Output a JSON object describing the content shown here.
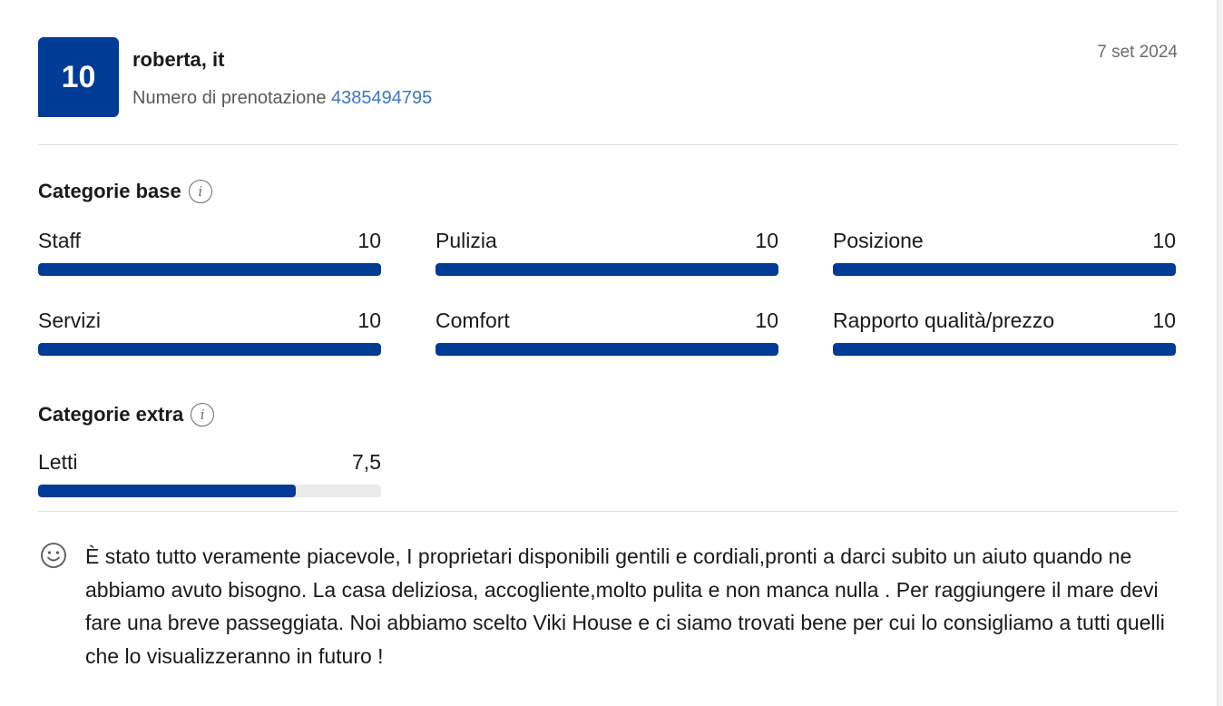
{
  "review": {
    "score": "10",
    "reviewer": "roberta, it",
    "booking_label": "Numero di prenotazione",
    "booking_number": "4385494795",
    "date": "7 set 2024"
  },
  "base_categories": {
    "title": "Categorie base",
    "items": [
      {
        "label": "Staff",
        "score": "10",
        "fraction": 1.0
      },
      {
        "label": "Pulizia",
        "score": "10",
        "fraction": 1.0
      },
      {
        "label": "Posizione",
        "score": "10",
        "fraction": 1.0
      },
      {
        "label": "Servizi",
        "score": "10",
        "fraction": 1.0
      },
      {
        "label": "Comfort",
        "score": "10",
        "fraction": 1.0
      },
      {
        "label": "Rapporto qualità/prezzo",
        "score": "10",
        "fraction": 1.0
      }
    ]
  },
  "extra_categories": {
    "title": "Categorie extra",
    "items": [
      {
        "label": "Letti",
        "score": "7,5",
        "fraction": 0.75
      }
    ]
  },
  "comment": {
    "icon": "smiley-icon",
    "text": "È stato tutto veramente piacevole, I proprietari disponibili gentili e cordiali,pronti a darci subito un aiuto quando ne abbiamo avuto bisogno. La casa deliziosa, accogliente,molto pulita e non manca nulla . Per raggiungere il mare devi fare una breve passeggiata. Noi abbiamo scelto Viki House e ci siamo trovati bene per cui lo consigliamo a tutti quelli che lo visualizzeranno in futuro !"
  },
  "colors": {
    "accent": "#003b95",
    "link": "#3b77c2",
    "track": "#ebebeb"
  }
}
